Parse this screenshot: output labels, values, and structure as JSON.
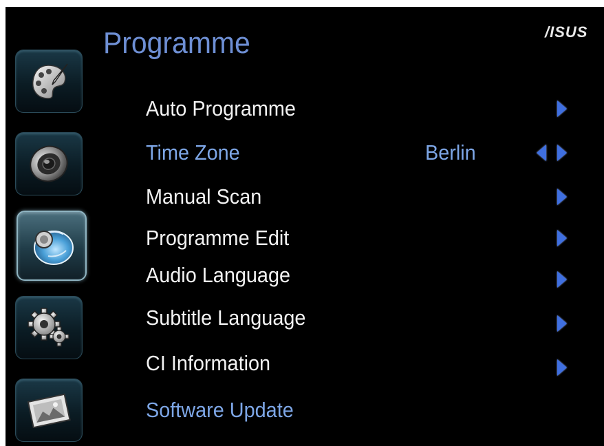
{
  "header": {
    "title": "Programme",
    "brand": "/ISUS"
  },
  "sidebar": {
    "items": [
      {
        "icon": "palette-icon",
        "active": false
      },
      {
        "icon": "speaker-icon",
        "active": false
      },
      {
        "icon": "satellite-dish-icon",
        "active": true
      },
      {
        "icon": "gears-icon",
        "active": false
      },
      {
        "icon": "picture-frame-icon",
        "active": false
      }
    ]
  },
  "menu": {
    "items": [
      {
        "label": "Auto Programme",
        "value": "",
        "highlighted": false,
        "arrows": "right"
      },
      {
        "label": "Time Zone",
        "value": "Berlin",
        "highlighted": true,
        "arrows": "both"
      },
      {
        "label": "Manual Scan",
        "value": "",
        "highlighted": false,
        "arrows": "right"
      },
      {
        "label": "Programme Edit",
        "value": "",
        "highlighted": false,
        "arrows": "right"
      },
      {
        "label": "Audio Language",
        "value": "",
        "highlighted": false,
        "arrows": "right"
      },
      {
        "label": "Subtitle Language",
        "value": "",
        "highlighted": false,
        "arrows": "right"
      },
      {
        "label": "CI Information",
        "value": "",
        "highlighted": false,
        "arrows": "right"
      },
      {
        "label": "Software Update",
        "value": "",
        "highlighted": true,
        "arrows": "none"
      }
    ]
  },
  "colors": {
    "background": "#000000",
    "title": "#6e8fd4",
    "highlight": "#7da6e6",
    "text": "#f2f2f2",
    "arrow": "#3f6fe0"
  }
}
